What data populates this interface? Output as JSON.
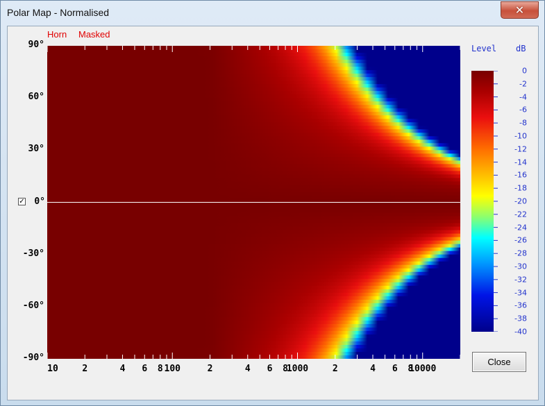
{
  "window": {
    "title": "Polar Map - Normalised",
    "close_glyph": "✕"
  },
  "legend": {
    "horn": "Horn",
    "masked": "Masked"
  },
  "checkbox": {
    "checked": true,
    "glyph": "✓"
  },
  "close_button": {
    "label": "Close"
  },
  "colors": {
    "accent_red": "#e00000",
    "scale_blue": "#2233cc",
    "outside_blue": "#00008b"
  },
  "chart_data": {
    "type": "heatmap",
    "title": "",
    "xlabel": "",
    "ylabel": "",
    "x_scale": "log",
    "xlim": [
      10,
      20000
    ],
    "ylim": [
      -90,
      90
    ],
    "x_tick_labels": [
      "10",
      "2",
      "4",
      "6",
      "8",
      "100",
      "2",
      "4",
      "6",
      "8",
      "1000",
      "2",
      "4",
      "6",
      "8",
      "10000"
    ],
    "y_tick_labels": [
      "90°",
      "60°",
      "30°",
      "0°",
      "-30°",
      "-60°",
      "-90°"
    ],
    "colorbar": {
      "title": "Level",
      "unit": "dB",
      "range": [
        -40,
        0
      ],
      "tick_labels": [
        "0",
        "-2",
        "-4",
        "-6",
        "-8",
        "-10",
        "-12",
        "-14",
        "-16",
        "-18",
        "-20",
        "-22",
        "-24",
        "-26",
        "-28",
        "-30",
        "-32",
        "-34",
        "-36",
        "-38",
        "-40"
      ]
    },
    "contours_dB_vs_freq": [
      {
        "freq": 300,
        "angle": 90,
        "level": -2
      },
      {
        "freq": 700,
        "angle": 90,
        "level": -6
      },
      {
        "freq": 1800,
        "angle": 90,
        "level": -12
      },
      {
        "freq": 2800,
        "angle": 90,
        "level": -20
      },
      {
        "freq": 3200,
        "angle": 90,
        "level": -40
      },
      {
        "freq": 20000,
        "angle": 22,
        "level": -40
      }
    ]
  }
}
